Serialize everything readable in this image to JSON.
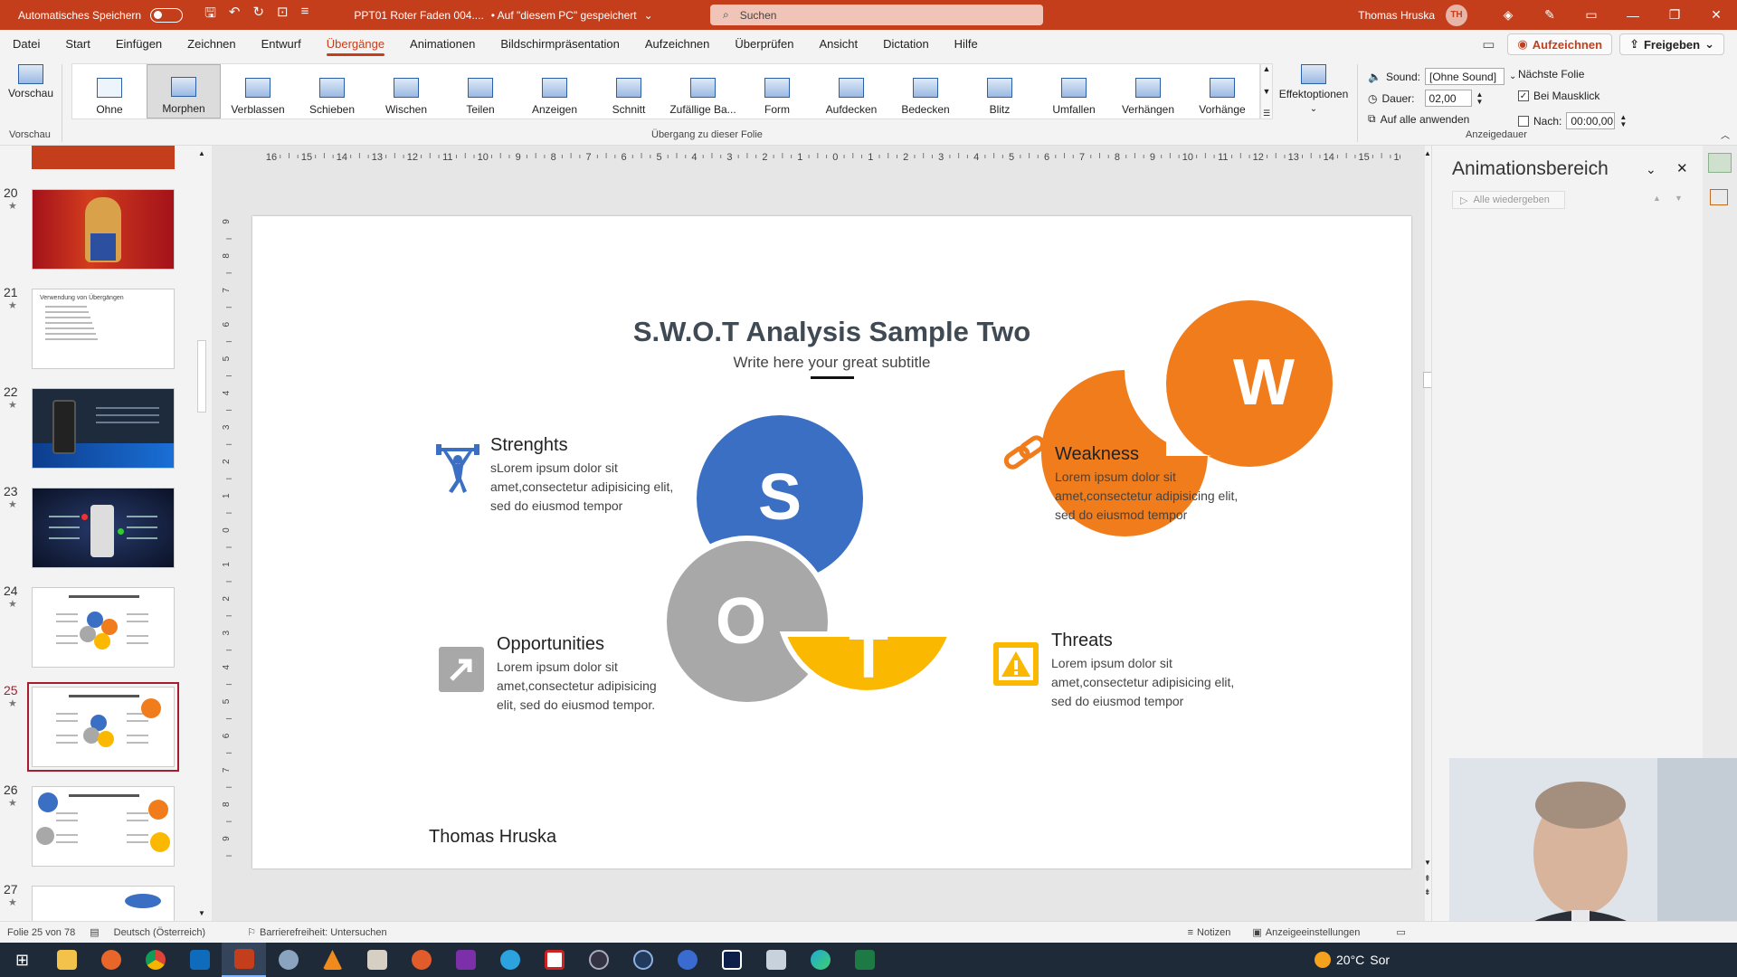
{
  "titlebar": {
    "autosave_label": "Automatisches Speichern",
    "doc_title": "PPT01 Roter Faden 004....",
    "saved_status": "• Auf \"diesem PC\" gespeichert",
    "search_placeholder": "Suchen",
    "user_name": "Thomas Hruska",
    "user_initials": "TH"
  },
  "menu": {
    "items": [
      "Datei",
      "Start",
      "Einfügen",
      "Zeichnen",
      "Entwurf",
      "Übergänge",
      "Animationen",
      "Bildschirmpräsentation",
      "Aufzeichnen",
      "Überprüfen",
      "Ansicht",
      "Dictation",
      "Hilfe"
    ],
    "active": "Übergänge",
    "record_label": "Aufzeichnen",
    "share_label": "Freigeben"
  },
  "ribbon": {
    "preview_label": "Vorschau",
    "preview_group": "Vorschau",
    "transitions": [
      "Ohne",
      "Morphen",
      "Verblassen",
      "Schieben",
      "Wischen",
      "Teilen",
      "Anzeigen",
      "Schnitt",
      "Zufällige Ba...",
      "Form",
      "Aufdecken",
      "Bedecken",
      "Blitz",
      "Umfallen",
      "Verhängen",
      "Vorhänge"
    ],
    "selected_transition": "Morphen",
    "transition_group": "Übergang zu dieser Folie",
    "effect_options": "Effektoptionen",
    "sound_label": "Sound:",
    "sound_value": "[Ohne Sound]",
    "duration_label": "Dauer:",
    "duration_value": "02,00",
    "apply_all": "Auf alle anwenden",
    "next_slide": "Nächste Folie",
    "on_click": "Bei Mausklick",
    "after_label": "Nach:",
    "after_value": "00:00,00",
    "timing_group": "Anzeigedauer"
  },
  "thumbnails": [
    {
      "num": "20",
      "kind": "photo"
    },
    {
      "num": "21",
      "kind": "text",
      "title": "Verwendung von Übergängen"
    },
    {
      "num": "22",
      "kind": "dark"
    },
    {
      "num": "23",
      "kind": "dark2"
    },
    {
      "num": "24",
      "kind": "swot"
    },
    {
      "num": "25",
      "kind": "swot-w",
      "selected": true
    },
    {
      "num": "26",
      "kind": "swot-spread"
    },
    {
      "num": "27",
      "kind": "oval"
    }
  ],
  "ruler": {
    "h_ticks": [
      "16",
      "15",
      "14",
      "13",
      "12",
      "11",
      "10",
      "9",
      "8",
      "7",
      "6",
      "5",
      "4",
      "3",
      "2",
      "1",
      "0",
      "1",
      "2",
      "3",
      "4",
      "5",
      "6",
      "7",
      "8",
      "9",
      "10",
      "11",
      "12",
      "13",
      "14",
      "15",
      "16"
    ],
    "v_ticks": [
      "9",
      "8",
      "7",
      "6",
      "5",
      "4",
      "3",
      "2",
      "1",
      "0",
      "1",
      "2",
      "3",
      "4",
      "5",
      "6",
      "7",
      "8",
      "9"
    ]
  },
  "slide": {
    "title": "S.W.O.T Analysis Sample Two",
    "subtitle": "Write here your great subtitle",
    "letters": {
      "s": "S",
      "w": "W",
      "o": "O",
      "t": "T"
    },
    "colors": {
      "s": "#3a6fc4",
      "w": "#f07c1c",
      "o": "#a8a8a8",
      "t": "#fbb800"
    },
    "strengths": {
      "title": "Strenghts",
      "text": "sLorem ipsum dolor sit amet,consectetur adipisicing elit, sed do eiusmod tempor"
    },
    "weakness": {
      "title": "Weakness",
      "text": "Lorem ipsum dolor sit amet,consectetur adipisicing elit, sed do eiusmod tempor"
    },
    "opportunities": {
      "title": "Opportunities",
      "text": "Lorem ipsum dolor sit amet,consectetur adipisicing elit, sed do eiusmod tempor."
    },
    "threats": {
      "title": "Threats",
      "text": "Lorem ipsum dolor sit amet,consectetur adipisicing elit, sed do eiusmod tempor"
    },
    "author": "Thomas Hruska"
  },
  "anim_pane": {
    "title": "Animationsbereich",
    "play_all": "Alle wiedergeben"
  },
  "status": {
    "slide_info": "Folie 25 von 78",
    "language": "Deutsch (Österreich)",
    "accessibility": "Barrierefreiheit: Untersuchen",
    "notes": "Notizen",
    "display_settings": "Anzeigeeinstellungen"
  },
  "taskbar": {
    "weather": "20°C",
    "weather_cut": "Sor"
  }
}
